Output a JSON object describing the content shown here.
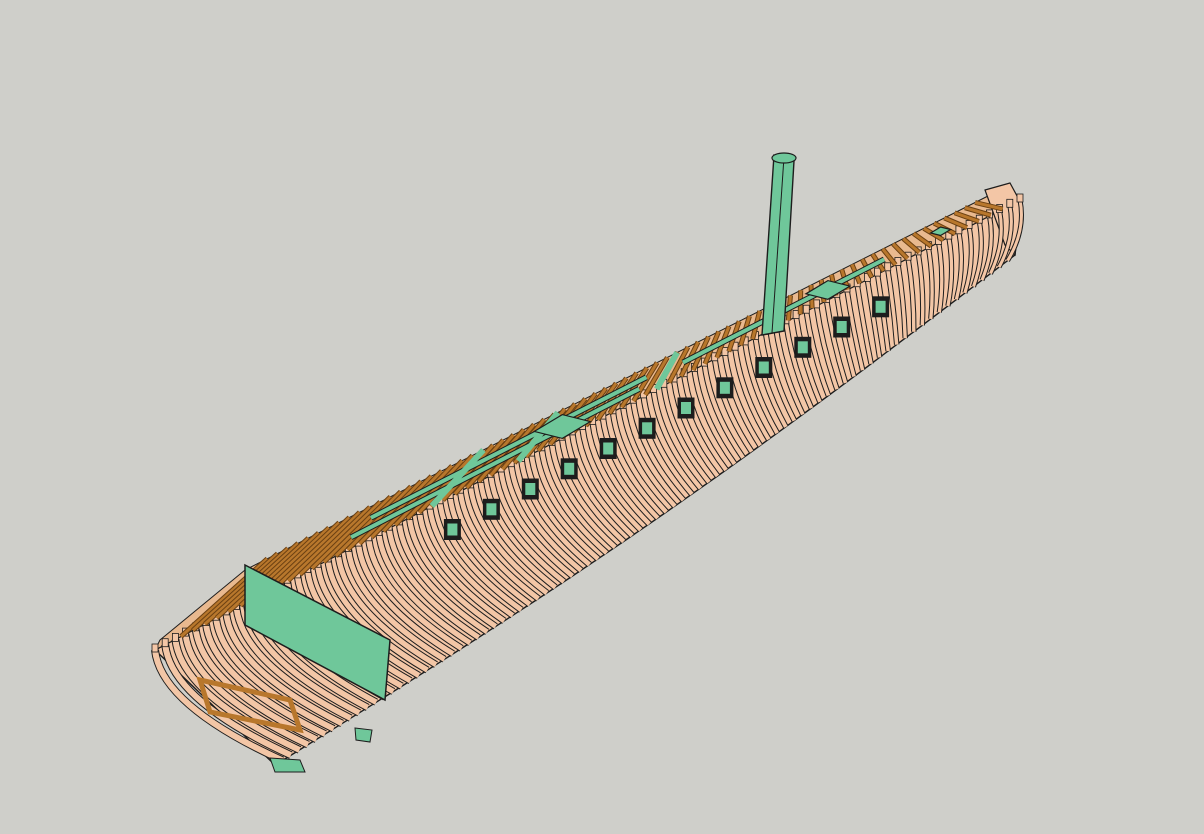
{
  "viewport": {
    "background_color": "#cfcfca"
  },
  "model": {
    "subject": "ship-hull-framing-model",
    "colors": {
      "frame_wood": "#f3c6a6",
      "deck_beam": "#b8772c",
      "deck_beam_dark": "#6b4012",
      "structural_green": "#6fc79a",
      "outline": "#1d1d1d"
    },
    "counts": {
      "frames": 86,
      "deck_beams": 70,
      "gun_ports": 12
    }
  }
}
